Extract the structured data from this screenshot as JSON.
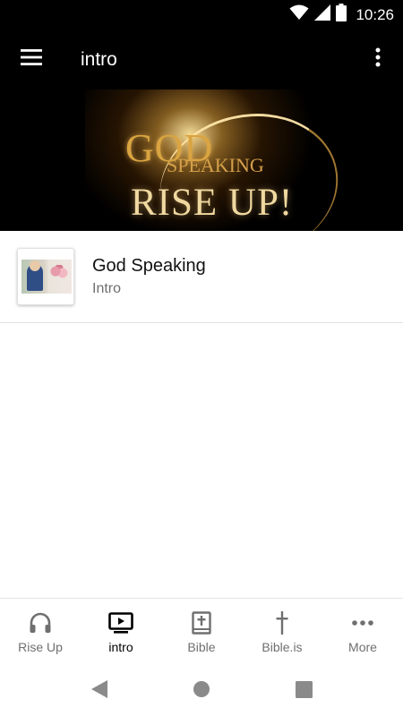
{
  "status_bar": {
    "time": "10:26",
    "icons": [
      "wifi-icon",
      "signal-icon",
      "battery-icon"
    ]
  },
  "app_bar": {
    "title": "intro",
    "menu_icon": "hamburger-menu-icon",
    "overflow_icon": "more-vertical-icon"
  },
  "banner": {
    "line1": "GOD",
    "line2": "SPEAKING",
    "line3": "RISE UP!"
  },
  "list": {
    "items": [
      {
        "title": "God Speaking",
        "subtitle": "Intro",
        "thumbnail": "video-thumbnail"
      }
    ]
  },
  "bottom_nav": {
    "active_index": 1,
    "items": [
      {
        "label": "Rise Up",
        "icon": "headphones-icon"
      },
      {
        "label": "intro",
        "icon": "video-player-icon"
      },
      {
        "label": "Bible",
        "icon": "bible-book-icon"
      },
      {
        "label": "Bible.is",
        "icon": "cross-icon"
      },
      {
        "label": "More",
        "icon": "more-horizontal-icon"
      }
    ]
  },
  "system_nav": {
    "icons": [
      "back-icon",
      "home-icon",
      "recents-icon"
    ]
  },
  "colors": {
    "app_bar": "#000000",
    "banner_gold": "#d9a441",
    "active_nav": "#000000",
    "inactive_nav": "#6f6f6f"
  }
}
